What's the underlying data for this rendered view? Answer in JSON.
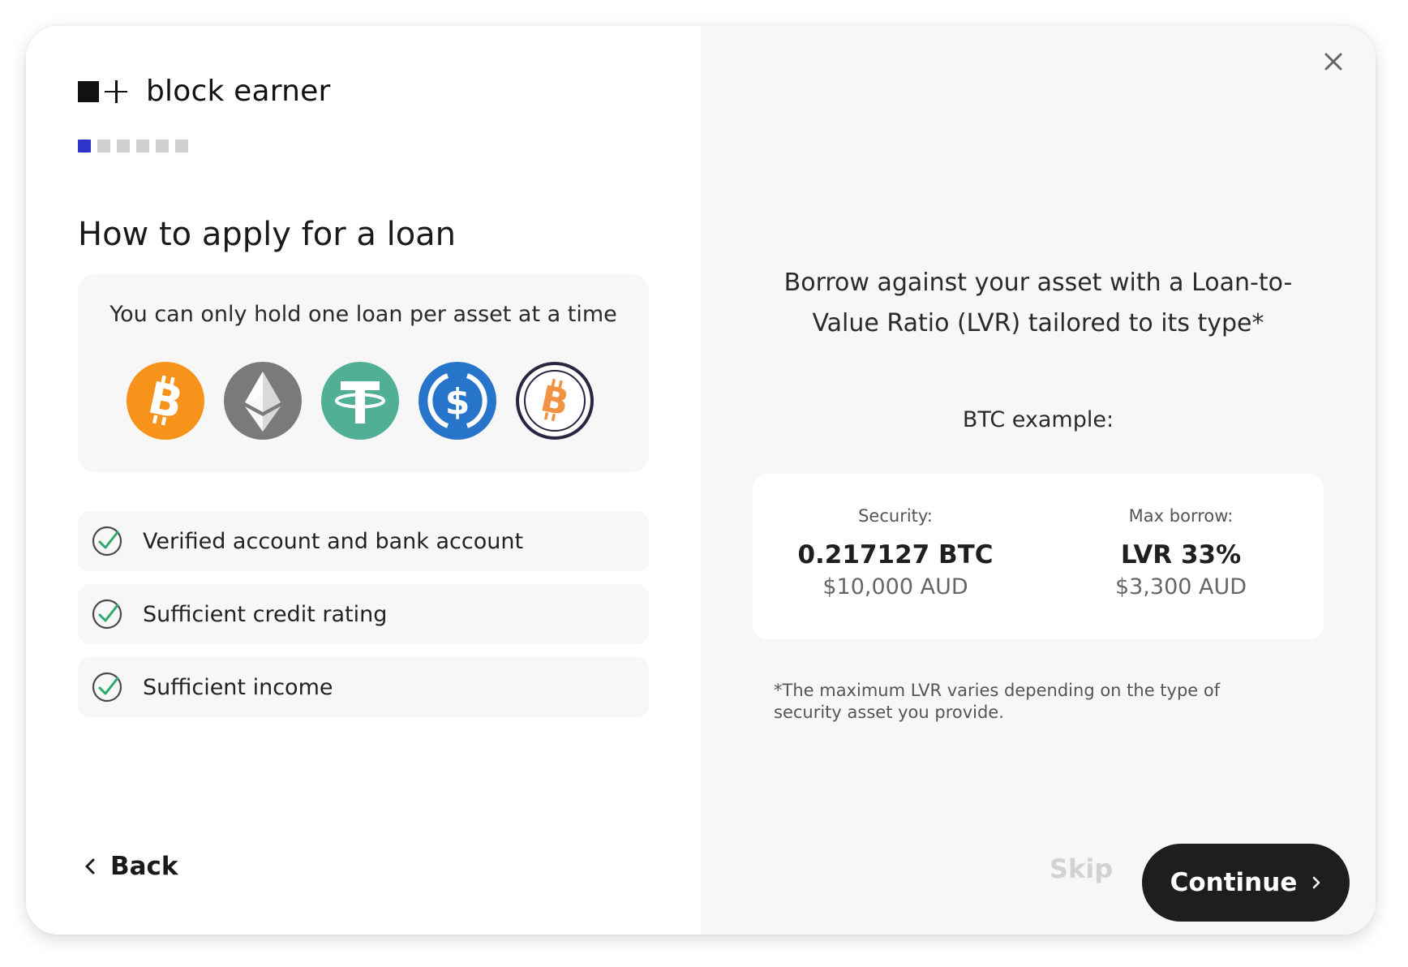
{
  "brand": {
    "name": "block earner"
  },
  "progress": {
    "current_step": 1,
    "total_steps": 6
  },
  "left": {
    "title": "How to apply for a loan",
    "asset_note": "You can only hold one loan per asset at a time",
    "assets": [
      {
        "icon": "bitcoin-icon",
        "color": "#F7931A"
      },
      {
        "icon": "ethereum-icon",
        "color": "#7A7A7A"
      },
      {
        "icon": "tether-icon",
        "color": "#50AF95"
      },
      {
        "icon": "usdc-icon",
        "color": "#2775CA"
      },
      {
        "icon": "wrapped-bitcoin-icon",
        "color": "#F09242"
      }
    ],
    "requirements": [
      {
        "label": "Verified account and bank account",
        "icon": "check-circle-icon"
      },
      {
        "label": "Sufficient credit rating",
        "icon": "check-circle-icon"
      },
      {
        "label": "Sufficient income",
        "icon": "check-circle-icon"
      }
    ],
    "back_label": "Back"
  },
  "right": {
    "headline_line1": "Borrow against your asset with a Loan-to-",
    "headline_line2": "Value Ratio (LVR) tailored to its type*",
    "example_label": "BTC example:",
    "security": {
      "label": "Security:",
      "value": "0.217127 BTC",
      "sub": "$10,000 AUD"
    },
    "max_borrow": {
      "label": "Max borrow:",
      "value": "LVR 33%",
      "sub": "$3,300 AUD"
    },
    "footnote": "*The maximum LVR varies depending on the type of security asset you provide.",
    "skip_label": "Skip",
    "continue_label": "Continue"
  },
  "colors": {
    "accent": "#2E35C8",
    "check": "#2EAA6E",
    "button": "#1E1E1E"
  }
}
